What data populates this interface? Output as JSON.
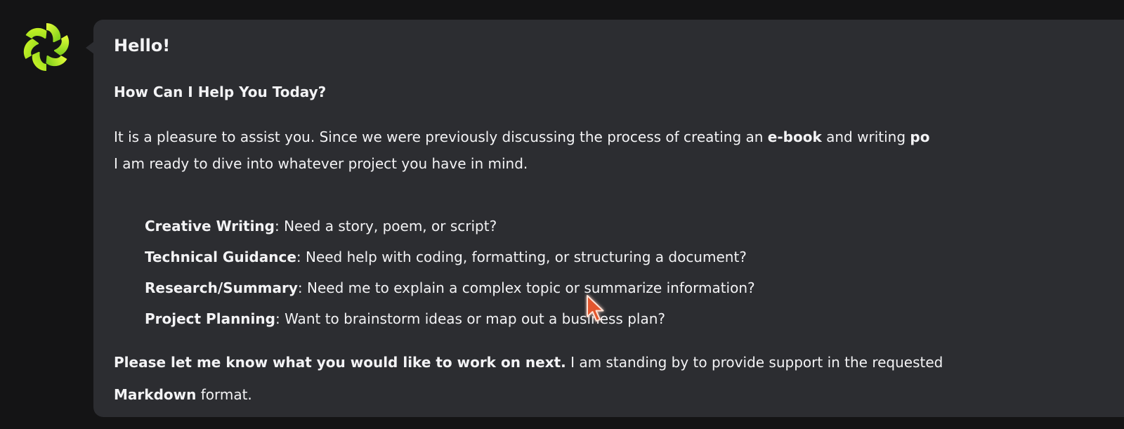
{
  "message": {
    "greeting": "Hello!",
    "subheading": "How Can I Help You Today?",
    "intro": {
      "line1_part1": "It is a pleasure to assist you. Since we were previously discussing the process of creating an ",
      "line1_bold1": "e-book",
      "line1_part2": " and writing ",
      "line1_bold2": "po",
      "line2": "I am ready to dive into whatever project you have in mind."
    },
    "options": [
      {
        "title": "Creative Writing",
        "text": ": Need a story, poem, or script?"
      },
      {
        "title": "Technical Guidance",
        "text": ": Need help with coding, formatting, or structuring a document?"
      },
      {
        "title": "Research/Summary",
        "text": ": Need me to explain a complex topic or summarize information?"
      },
      {
        "title": "Project Planning",
        "text": ": Want to brainstorm ideas or map out a business plan?"
      }
    ],
    "closing": {
      "bold": "Please let me know what you would like to work on next.",
      "text1": " I am standing by to provide support in the requested",
      "bold2": "Markdown",
      "text2": " format."
    }
  },
  "colors": {
    "background": "#141415",
    "bubble": "#2c2d31",
    "text": "#f3f3f5",
    "logo_primary": "#b8ee1a",
    "logo_secondary": "#7fd21a",
    "cursor_fill": "#e3562f"
  },
  "icons": {
    "avatar": "assistant-logo-icon",
    "cursor": "mouse-pointer-icon"
  }
}
